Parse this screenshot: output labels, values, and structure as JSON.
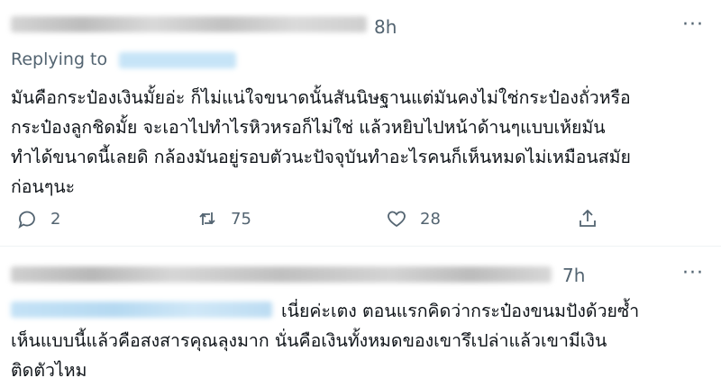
{
  "tweets": [
    {
      "time": "8h",
      "more_label": "···",
      "replying_label": "Replying to",
      "body": "มันคือกระป๋องเงินมั้ยอ่ะ ก็ไม่แน่ใจขนาดนั้นสันนิษฐานแต่มันคงไม่ใช่กระป๋องถั่วหรือ\nกระป๋องลูกชิดมั้ย จะเอาไปทำไรหิวหรอก็ไม่ใช่ แล้วหยิบไปหน้าด้านๆแบบเห้ยมัน\nทำได้ขนาดนี้เลยดิ กล้องมันอยู่รอบตัวนะปัจจุบันทำอะไรคนก็เห็นหมดไม่เหมือนสมัย\nก่อนๆนะ",
      "actions": {
        "reply_count": "2",
        "retweet_count": "75",
        "like_count": "28"
      }
    },
    {
      "time": "7h",
      "more_label": "···",
      "body": "เนี่ยค่ะเตง ตอนแรกคิดว่ากระป๋องขนมปังด้วยซ้ำ\nเห็นแบบนี้แล้วคือสงสารคุณลุงมาก นั่นคือเงินทั้งหมดของเขารึเปล่าแล้วเขามีเงิน\nติดตัวไหม"
    }
  ],
  "colors": {
    "text": "#0f1419",
    "secondary": "#536471",
    "divider": "#eff3f4",
    "mention_blur": "#c6e4f7"
  }
}
